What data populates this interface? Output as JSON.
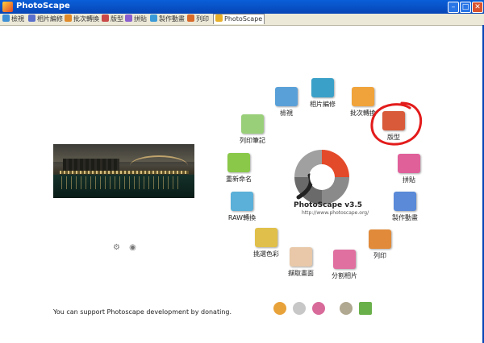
{
  "window": {
    "title": "PhotoScape"
  },
  "tabs": [
    {
      "label": "檢視",
      "color": "#3d8fd6"
    },
    {
      "label": "相片編修",
      "color": "#5a6fcc"
    },
    {
      "label": "批次轉換",
      "color": "#e08a2a"
    },
    {
      "label": "版型",
      "color": "#c94848"
    },
    {
      "label": "拼貼",
      "color": "#8a5fcf"
    },
    {
      "label": "製作動畫",
      "color": "#3a9ad8"
    },
    {
      "label": "列印",
      "color": "#d86a2a"
    },
    {
      "label": "PhotoScape",
      "color": "#e8b02a",
      "active": true
    }
  ],
  "hub": {
    "product": "PhotoScape v3.5",
    "url": "http://www.photoscape.org/",
    "items": [
      {
        "id": "viewer",
        "label": "檢視",
        "color": "#5aa0d8"
      },
      {
        "id": "editor",
        "label": "相片編修",
        "color": "#3aa0c8"
      },
      {
        "id": "batch",
        "label": "批次轉換",
        "color": "#f0a33a"
      },
      {
        "id": "page",
        "label": "版型",
        "color": "#d85a3a"
      },
      {
        "id": "combine",
        "label": "拼貼",
        "color": "#e0609a"
      },
      {
        "id": "animated",
        "label": "製作動畫",
        "color": "#5a8ad8"
      },
      {
        "id": "print",
        "label": "列印",
        "color": "#e08a3a"
      },
      {
        "id": "splitter",
        "label": "分割相片",
        "color": "#e070a0"
      },
      {
        "id": "screen-capture",
        "label": "擷取畫面",
        "color": "#e8c8a8"
      },
      {
        "id": "color-picker",
        "label": "挑選色彩",
        "color": "#e0c04a"
      },
      {
        "id": "raw",
        "label": "RAW轉換",
        "color": "#5ab0d8"
      },
      {
        "id": "rename",
        "label": "重新命名",
        "color": "#8ac84a"
      },
      {
        "id": "paper-print",
        "label": "列印筆記",
        "color": "#9acf7a"
      }
    ]
  },
  "footer": {
    "donate_text": "You can support Photoscape development by donating."
  },
  "colors": {
    "title_bar": "#0745b6",
    "tab_bar": "#ece9d8",
    "highlight_circle": "#e31b1b"
  }
}
